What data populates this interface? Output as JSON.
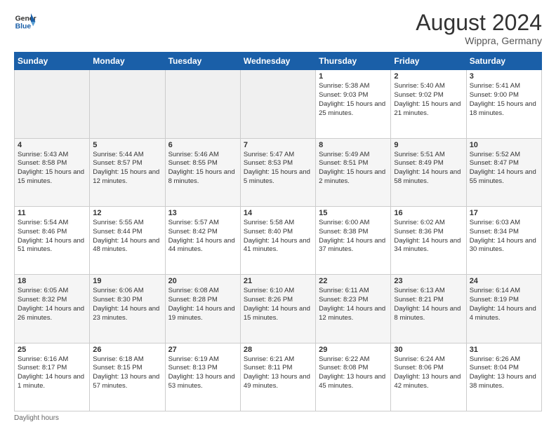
{
  "header": {
    "logo_line1": "General",
    "logo_line2": "Blue",
    "month_title": "August 2024",
    "location": "Wippra, Germany"
  },
  "weekdays": [
    "Sunday",
    "Monday",
    "Tuesday",
    "Wednesday",
    "Thursday",
    "Friday",
    "Saturday"
  ],
  "footer": "Daylight hours",
  "weeks": [
    [
      {
        "day": "",
        "sunrise": "",
        "sunset": "",
        "daylight": "",
        "empty": true
      },
      {
        "day": "",
        "sunrise": "",
        "sunset": "",
        "daylight": "",
        "empty": true
      },
      {
        "day": "",
        "sunrise": "",
        "sunset": "",
        "daylight": "",
        "empty": true
      },
      {
        "day": "",
        "sunrise": "",
        "sunset": "",
        "daylight": "",
        "empty": true
      },
      {
        "day": "1",
        "sunrise": "5:38 AM",
        "sunset": "9:03 PM",
        "daylight": "15 hours and 25 minutes."
      },
      {
        "day": "2",
        "sunrise": "5:40 AM",
        "sunset": "9:02 PM",
        "daylight": "15 hours and 21 minutes."
      },
      {
        "day": "3",
        "sunrise": "5:41 AM",
        "sunset": "9:00 PM",
        "daylight": "15 hours and 18 minutes."
      }
    ],
    [
      {
        "day": "4",
        "sunrise": "5:43 AM",
        "sunset": "8:58 PM",
        "daylight": "15 hours and 15 minutes."
      },
      {
        "day": "5",
        "sunrise": "5:44 AM",
        "sunset": "8:57 PM",
        "daylight": "15 hours and 12 minutes."
      },
      {
        "day": "6",
        "sunrise": "5:46 AM",
        "sunset": "8:55 PM",
        "daylight": "15 hours and 8 minutes."
      },
      {
        "day": "7",
        "sunrise": "5:47 AM",
        "sunset": "8:53 PM",
        "daylight": "15 hours and 5 minutes."
      },
      {
        "day": "8",
        "sunrise": "5:49 AM",
        "sunset": "8:51 PM",
        "daylight": "15 hours and 2 minutes."
      },
      {
        "day": "9",
        "sunrise": "5:51 AM",
        "sunset": "8:49 PM",
        "daylight": "14 hours and 58 minutes."
      },
      {
        "day": "10",
        "sunrise": "5:52 AM",
        "sunset": "8:47 PM",
        "daylight": "14 hours and 55 minutes."
      }
    ],
    [
      {
        "day": "11",
        "sunrise": "5:54 AM",
        "sunset": "8:46 PM",
        "daylight": "14 hours and 51 minutes."
      },
      {
        "day": "12",
        "sunrise": "5:55 AM",
        "sunset": "8:44 PM",
        "daylight": "14 hours and 48 minutes."
      },
      {
        "day": "13",
        "sunrise": "5:57 AM",
        "sunset": "8:42 PM",
        "daylight": "14 hours and 44 minutes."
      },
      {
        "day": "14",
        "sunrise": "5:58 AM",
        "sunset": "8:40 PM",
        "daylight": "14 hours and 41 minutes."
      },
      {
        "day": "15",
        "sunrise": "6:00 AM",
        "sunset": "8:38 PM",
        "daylight": "14 hours and 37 minutes."
      },
      {
        "day": "16",
        "sunrise": "6:02 AM",
        "sunset": "8:36 PM",
        "daylight": "14 hours and 34 minutes."
      },
      {
        "day": "17",
        "sunrise": "6:03 AM",
        "sunset": "8:34 PM",
        "daylight": "14 hours and 30 minutes."
      }
    ],
    [
      {
        "day": "18",
        "sunrise": "6:05 AM",
        "sunset": "8:32 PM",
        "daylight": "14 hours and 26 minutes."
      },
      {
        "day": "19",
        "sunrise": "6:06 AM",
        "sunset": "8:30 PM",
        "daylight": "14 hours and 23 minutes."
      },
      {
        "day": "20",
        "sunrise": "6:08 AM",
        "sunset": "8:28 PM",
        "daylight": "14 hours and 19 minutes."
      },
      {
        "day": "21",
        "sunrise": "6:10 AM",
        "sunset": "8:26 PM",
        "daylight": "14 hours and 15 minutes."
      },
      {
        "day": "22",
        "sunrise": "6:11 AM",
        "sunset": "8:23 PM",
        "daylight": "14 hours and 12 minutes."
      },
      {
        "day": "23",
        "sunrise": "6:13 AM",
        "sunset": "8:21 PM",
        "daylight": "14 hours and 8 minutes."
      },
      {
        "day": "24",
        "sunrise": "6:14 AM",
        "sunset": "8:19 PM",
        "daylight": "14 hours and 4 minutes."
      }
    ],
    [
      {
        "day": "25",
        "sunrise": "6:16 AM",
        "sunset": "8:17 PM",
        "daylight": "14 hours and 1 minute."
      },
      {
        "day": "26",
        "sunrise": "6:18 AM",
        "sunset": "8:15 PM",
        "daylight": "13 hours and 57 minutes."
      },
      {
        "day": "27",
        "sunrise": "6:19 AM",
        "sunset": "8:13 PM",
        "daylight": "13 hours and 53 minutes."
      },
      {
        "day": "28",
        "sunrise": "6:21 AM",
        "sunset": "8:11 PM",
        "daylight": "13 hours and 49 minutes."
      },
      {
        "day": "29",
        "sunrise": "6:22 AM",
        "sunset": "8:08 PM",
        "daylight": "13 hours and 45 minutes."
      },
      {
        "day": "30",
        "sunrise": "6:24 AM",
        "sunset": "8:06 PM",
        "daylight": "13 hours and 42 minutes."
      },
      {
        "day": "31",
        "sunrise": "6:26 AM",
        "sunset": "8:04 PM",
        "daylight": "13 hours and 38 minutes."
      }
    ]
  ]
}
